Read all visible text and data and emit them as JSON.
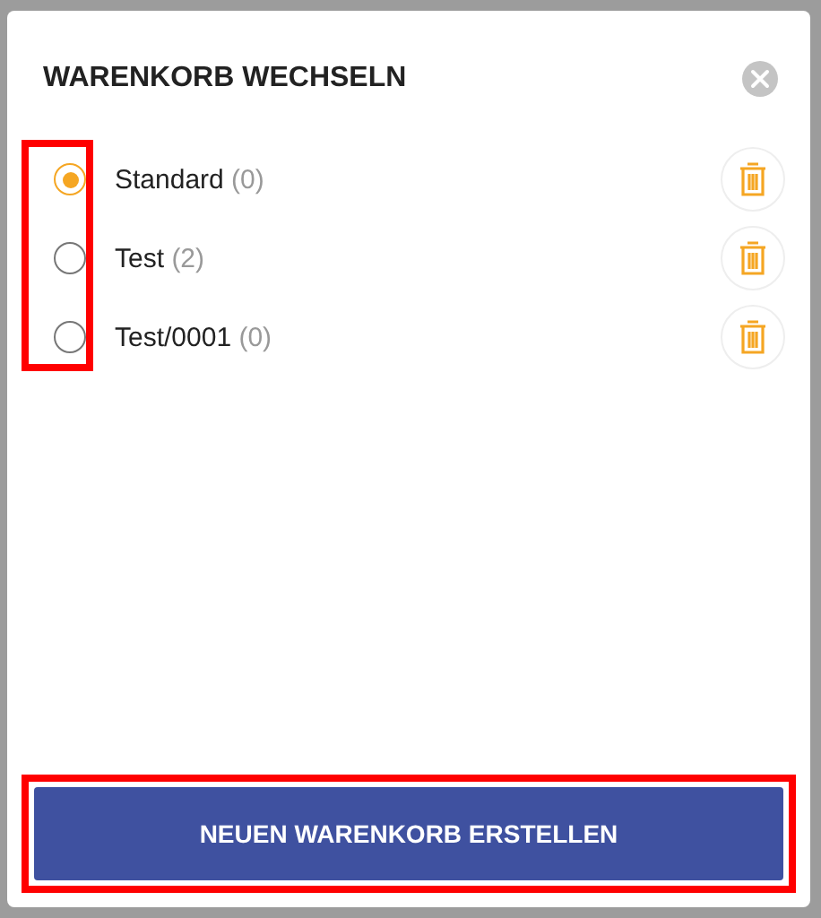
{
  "dialog": {
    "title": "WARENKORB WECHSELN",
    "radios_highlighted": true
  },
  "carts": [
    {
      "name": "Standard",
      "count": "(0)",
      "selected": true
    },
    {
      "name": "Test",
      "count": "(2)",
      "selected": false
    },
    {
      "name": "Test/0001",
      "count": "(0)",
      "selected": false
    }
  ],
  "create_button": {
    "label": "NEUEN WARENKORB ERSTELLEN",
    "highlighted": true
  }
}
